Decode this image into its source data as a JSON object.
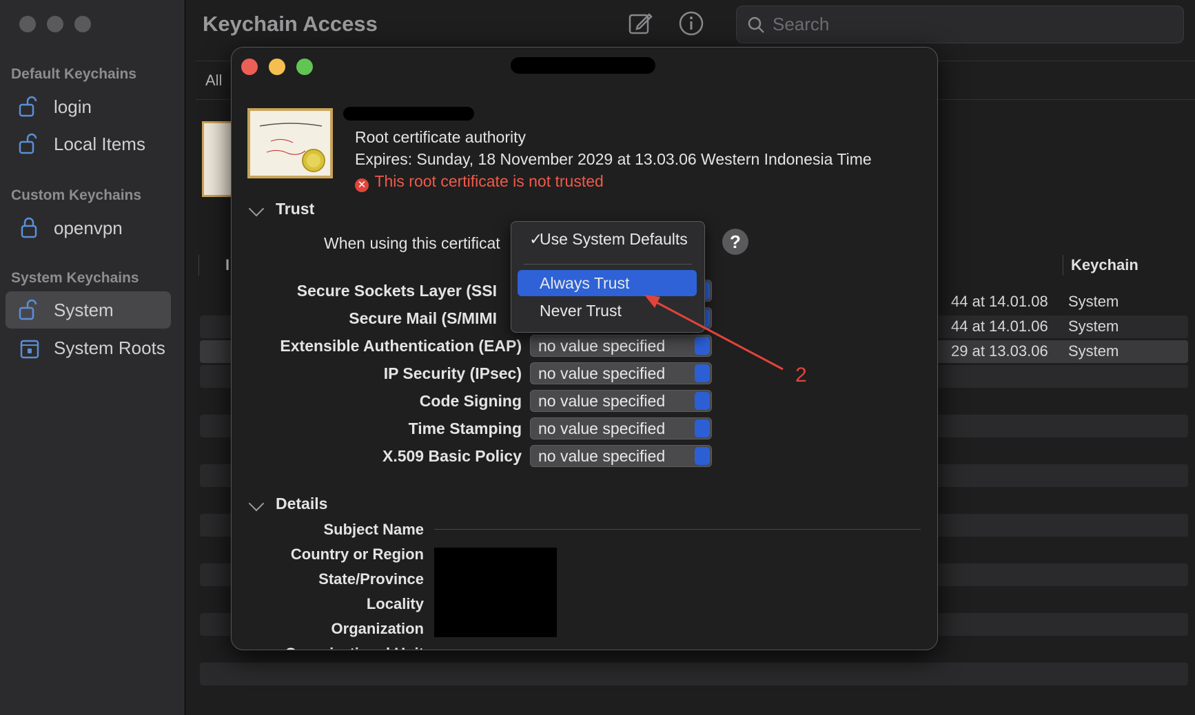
{
  "window": {
    "title": "Keychain Access"
  },
  "toolbar": {
    "compose_icon": "compose-icon",
    "info_icon": "info-icon",
    "search_placeholder": "Search"
  },
  "sidebar": {
    "sections": [
      {
        "title": "Default Keychains",
        "items": [
          {
            "label": "login"
          },
          {
            "label": "Local Items"
          }
        ]
      },
      {
        "title": "Custom Keychains",
        "items": [
          {
            "label": "openvpn"
          }
        ]
      },
      {
        "title": "System Keychains",
        "items": [
          {
            "label": "System",
            "selected": true
          },
          {
            "label": "System Roots"
          }
        ]
      }
    ]
  },
  "tabs": {
    "all": "All"
  },
  "table": {
    "columns": {
      "first": "I",
      "keychain": "Keychain"
    },
    "rows": [
      {
        "date": "44 at 14.01.08",
        "keychain": "System"
      },
      {
        "date": "44 at 14.01.06",
        "keychain": "System"
      },
      {
        "date": "29 at 13.03.06",
        "keychain": "System",
        "selected": true
      }
    ]
  },
  "dialog": {
    "cert_type": "Root certificate authority",
    "expires": "Expires: Sunday, 18 November 2029 at 13.03.06 Western Indonesia Time",
    "trust_status": "This root certificate is not trusted",
    "trust_section": "Trust",
    "when_using": "When using this certificat",
    "policies": [
      {
        "label": "Secure Sockets Layer (SSI",
        "value": ""
      },
      {
        "label": "Secure Mail (S/MIMI",
        "value": ""
      },
      {
        "label": "Extensible Authentication (EAP)",
        "value": "no value specified"
      },
      {
        "label": "IP Security (IPsec)",
        "value": "no value specified"
      },
      {
        "label": "Code Signing",
        "value": "no value specified"
      },
      {
        "label": "Time Stamping",
        "value": "no value specified"
      },
      {
        "label": "X.509 Basic Policy",
        "value": "no value specified"
      }
    ],
    "help": "?",
    "details_section": "Details",
    "details": {
      "subject_name": "Subject Name",
      "country": "Country or Region",
      "state": "State/Province",
      "locality": "Locality",
      "organization": "Organization",
      "org_unit": "Organizational Unit"
    }
  },
  "dropdown_menu": {
    "checkmark": "✓",
    "items": [
      "Use System Defaults",
      "Always Trust",
      "Never Trust"
    ],
    "selected": "Use System Defaults",
    "highlighted": "Always Trust"
  },
  "annotation": {
    "label": "2",
    "color": "#e2443a"
  },
  "colors": {
    "accent": "#2e62d6",
    "error": "#f05a4a",
    "close": "#ec5f57",
    "minimize": "#f4bf4f",
    "zoom": "#61c554"
  }
}
